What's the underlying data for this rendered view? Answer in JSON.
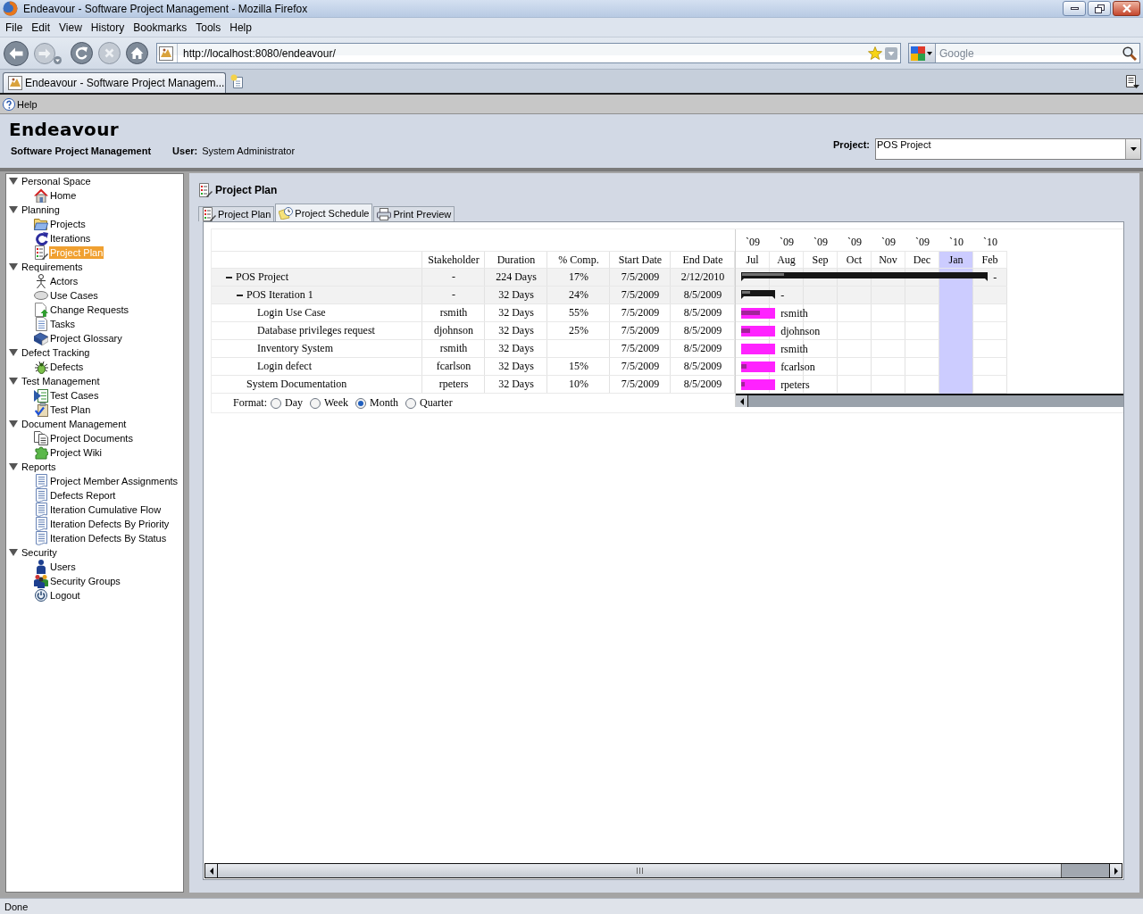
{
  "window": {
    "title": "Endeavour - Software Project Management - Mozilla Firefox"
  },
  "menu_bar": [
    "File",
    "Edit",
    "View",
    "History",
    "Bookmarks",
    "Tools",
    "Help"
  ],
  "address_bar": {
    "url": "http://localhost:8080/endeavour/"
  },
  "search": {
    "placeholder": "Google"
  },
  "browser_tabs": [
    {
      "label": "Endeavour - Software Project Managem...",
      "selected": true
    }
  ],
  "help_toolbar": {
    "label": "Help"
  },
  "header": {
    "app_title": "Endeavour",
    "subtitle": "Software Project Management",
    "user_label": "User:",
    "user_name": "System Administrator",
    "project_label": "Project:",
    "project_value": "POS Project"
  },
  "sidebar": {
    "groups": [
      {
        "label": "Personal Space",
        "expanded": true,
        "children": [
          {
            "label": "Home",
            "selected": false
          }
        ]
      },
      {
        "label": "Planning",
        "expanded": true,
        "children": [
          {
            "label": "Projects",
            "selected": false
          },
          {
            "label": "Iterations",
            "selected": false
          },
          {
            "label": "Project Plan",
            "selected": true
          }
        ]
      },
      {
        "label": "Requirements",
        "expanded": true,
        "children": [
          {
            "label": "Actors",
            "selected": false
          },
          {
            "label": "Use Cases",
            "selected": false
          },
          {
            "label": "Change Requests",
            "selected": false
          },
          {
            "label": "Tasks",
            "selected": false
          },
          {
            "label": "Project Glossary",
            "selected": false
          }
        ]
      },
      {
        "label": "Defect Tracking",
        "expanded": true,
        "children": [
          {
            "label": "Defects",
            "selected": false
          }
        ]
      },
      {
        "label": "Test Management",
        "expanded": true,
        "children": [
          {
            "label": "Test Cases",
            "selected": false
          },
          {
            "label": "Test Plan",
            "selected": false
          }
        ]
      },
      {
        "label": "Document Management",
        "expanded": true,
        "children": [
          {
            "label": "Project Documents",
            "selected": false
          },
          {
            "label": "Project Wiki",
            "selected": false
          }
        ]
      },
      {
        "label": "Reports",
        "expanded": true,
        "children": [
          {
            "label": "Project Member Assignments",
            "selected": false
          },
          {
            "label": "Defects Report",
            "selected": false
          },
          {
            "label": "Iteration Cumulative Flow",
            "selected": false
          },
          {
            "label": "Iteration Defects By Priority",
            "selected": false
          },
          {
            "label": "Iteration Defects By Status",
            "selected": false
          }
        ]
      },
      {
        "label": "Security",
        "expanded": true,
        "children": [
          {
            "label": "Users",
            "selected": false
          },
          {
            "label": "Security Groups",
            "selected": false
          },
          {
            "label": "Logout",
            "selected": false
          }
        ]
      }
    ]
  },
  "page": {
    "title": "Project Plan",
    "tabs": [
      {
        "label": "Project Plan",
        "selected": false
      },
      {
        "label": "Project Schedule",
        "selected": true
      },
      {
        "label": "Print Preview",
        "selected": false
      }
    ]
  },
  "schedule": {
    "columns": [
      "Stakeholder",
      "Duration",
      "% Comp.",
      "Start Date",
      "End Date"
    ],
    "rows": [
      {
        "name": "POS Project",
        "kind": "summary",
        "expanded": true,
        "stakeholder": "-",
        "duration": "224 Days",
        "complete": "17%",
        "start": "7/5/2009",
        "end": "2/12/2010",
        "bar_label": "-",
        "level": 0.17,
        "children": [
          {
            "name": "POS Iteration 1",
            "kind": "summary",
            "expanded": true,
            "stakeholder": "-",
            "duration": "32 Days",
            "complete": "24%",
            "start": "7/5/2009",
            "end": "8/5/2009",
            "bar_label": "-",
            "level": 0.24,
            "children": [
              {
                "name": "Login Use Case",
                "kind": "task",
                "stakeholder": "rsmith",
                "duration": "32 Days",
                "complete": "55%",
                "start": "7/5/2009",
                "end": "8/5/2009",
                "bar_label": "rsmith",
                "level": 0.55
              },
              {
                "name": "Database privileges request",
                "kind": "task",
                "stakeholder": "djohnson",
                "duration": "32 Days",
                "complete": "25%",
                "start": "7/5/2009",
                "end": "8/5/2009",
                "bar_label": "djohnson",
                "level": 0.25
              },
              {
                "name": "Inventory System",
                "kind": "task",
                "stakeholder": "rsmith",
                "duration": "32 Days",
                "start": "7/5/2009",
                "end": "8/5/2009",
                "bar_label": "rsmith"
              },
              {
                "name": "Login defect",
                "kind": "task",
                "stakeholder": "fcarlson",
                "duration": "32 Days",
                "complete": "15%",
                "start": "7/5/2009",
                "end": "8/5/2009",
                "bar_label": "fcarlson",
                "level": 0.15
              }
            ]
          },
          {
            "name": "System Documentation",
            "kind": "task",
            "stakeholder": "rpeters",
            "duration": "32 Days",
            "complete": "10%",
            "start": "7/5/2009",
            "end": "8/5/2009",
            "bar_label": "rpeters",
            "level": 0.1
          }
        ]
      }
    ],
    "timeline": [
      {
        "year": "`09",
        "month": "Jul",
        "current": false
      },
      {
        "year": "`09",
        "month": "Aug",
        "current": false
      },
      {
        "year": "`09",
        "month": "Sep",
        "current": false
      },
      {
        "year": "`09",
        "month": "Oct",
        "current": false
      },
      {
        "year": "`09",
        "month": "Nov",
        "current": false
      },
      {
        "year": "`09",
        "month": "Dec",
        "current": false
      },
      {
        "year": "`10",
        "month": "Jan",
        "current": true
      },
      {
        "year": "`10",
        "month": "Feb",
        "current": false
      }
    ],
    "format": {
      "label": "Format:",
      "options": [
        {
          "label": "Day",
          "selected": false
        },
        {
          "label": "Week",
          "selected": false
        },
        {
          "label": "Month",
          "selected": true
        },
        {
          "label": "Quarter",
          "selected": false
        }
      ]
    }
  },
  "status_bar": {
    "text": "Done"
  }
}
